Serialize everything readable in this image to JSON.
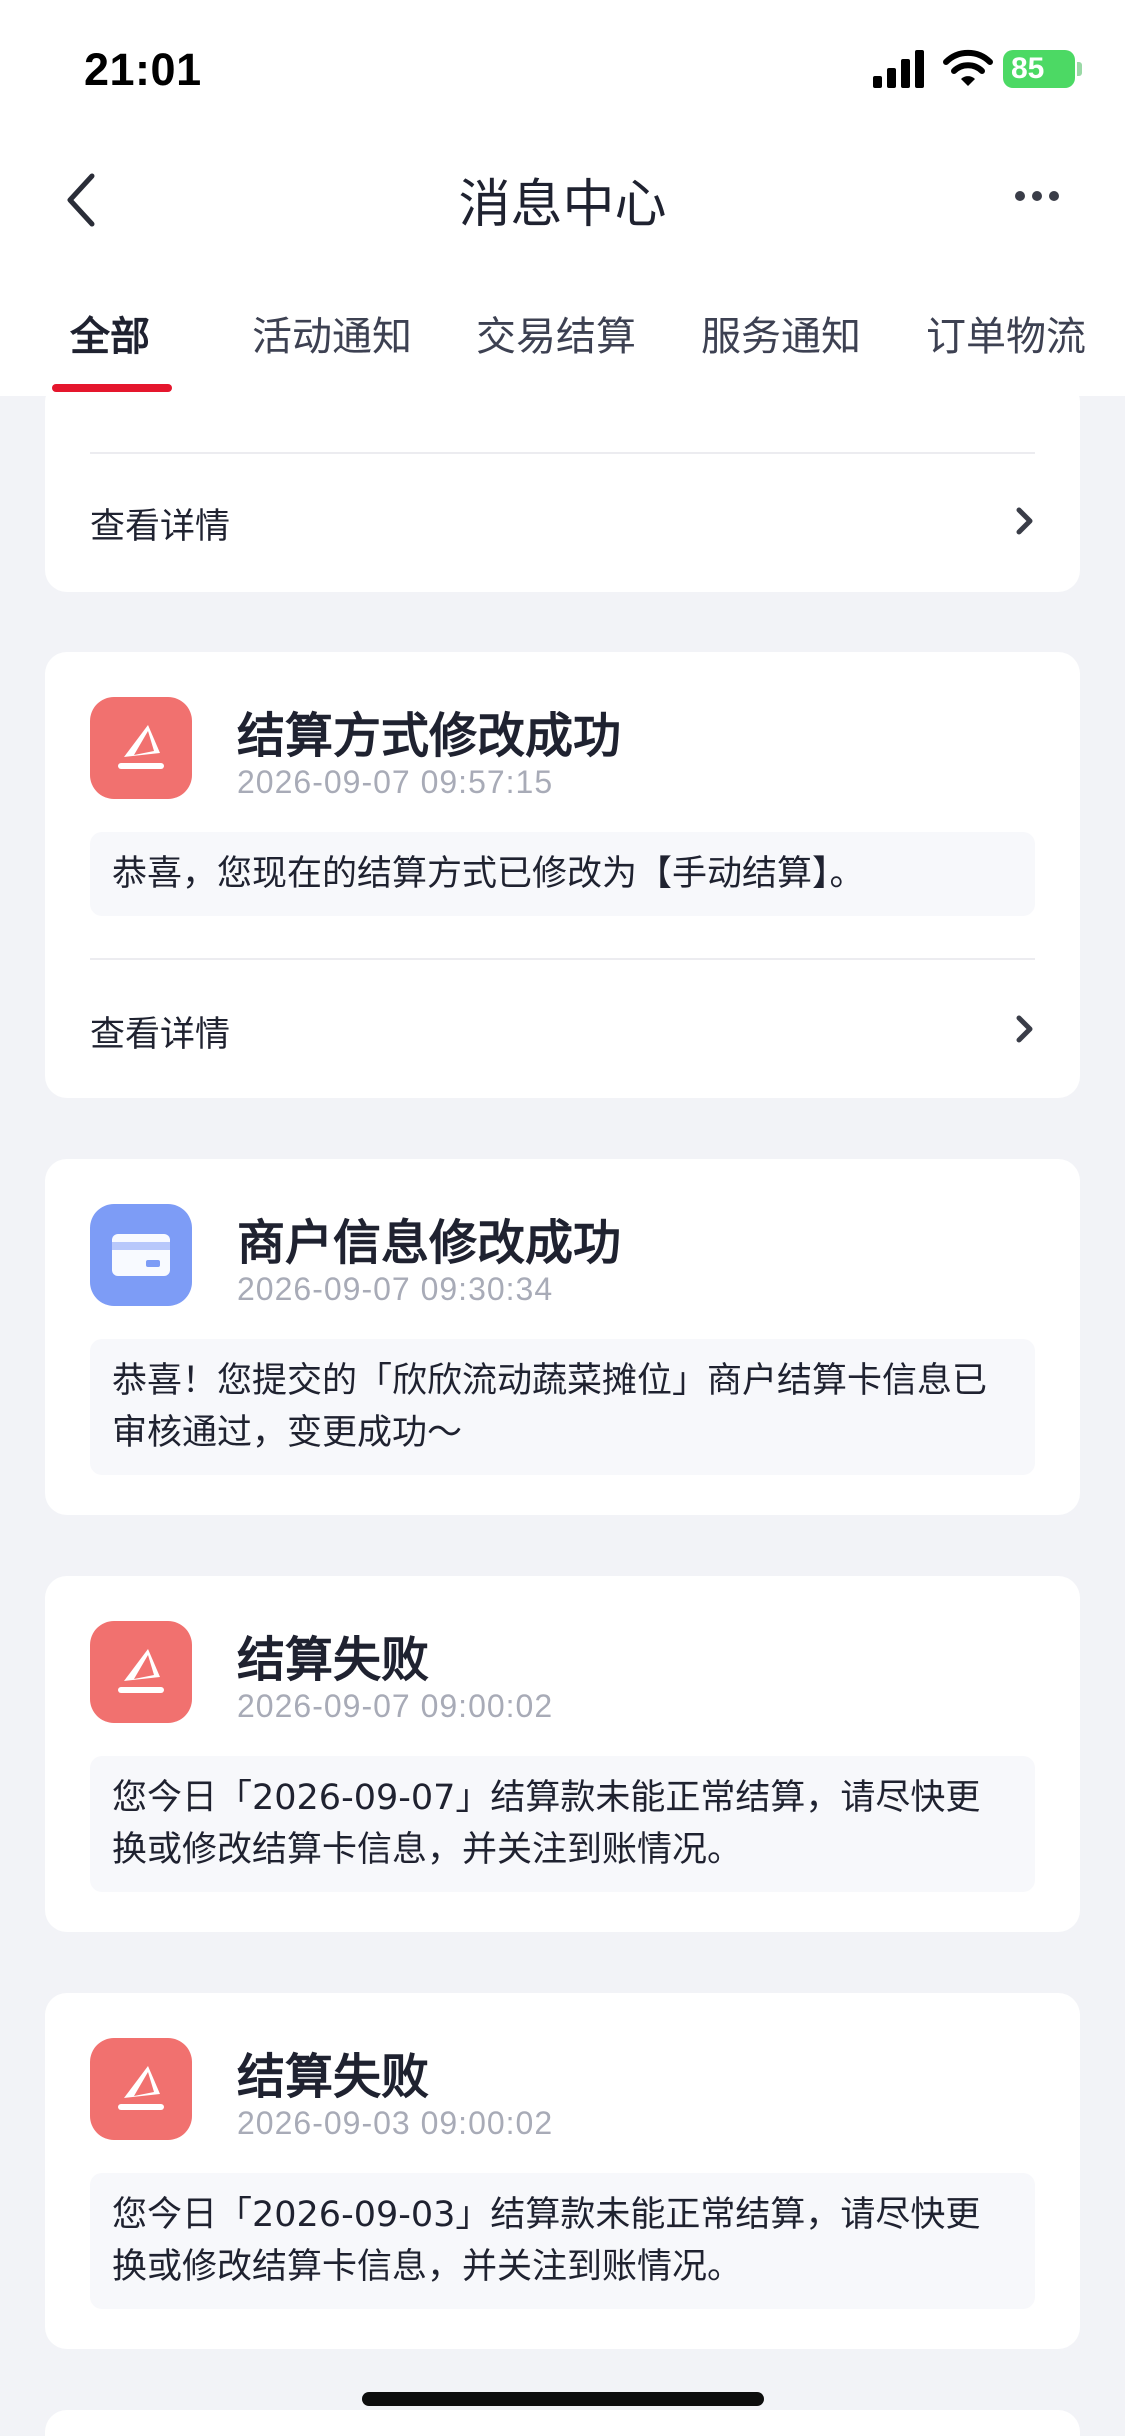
{
  "status_bar": {
    "time": "21:01",
    "battery": "85"
  },
  "nav": {
    "title": "消息中心"
  },
  "tabs": [
    {
      "label": "全部"
    },
    {
      "label": "活动通知"
    },
    {
      "label": "交易结算"
    },
    {
      "label": "服务通知"
    },
    {
      "label": "订单物流"
    }
  ],
  "messages": [
    {
      "detail_label": "查看详情"
    },
    {
      "icon": "settlement-icon",
      "title": "结算方式修改成功",
      "time": "2026-09-07 09:57:15",
      "body": "恭喜，您现在的结算方式已修改为【手动结算】。",
      "detail_label": "查看详情"
    },
    {
      "icon": "card-icon",
      "title": "商户信息修改成功",
      "time": "2026-09-07 09:30:34",
      "body": "恭喜！您提交的「欣欣流动蔬菜摊位」商户结算卡信息已审核通过，变更成功～"
    },
    {
      "icon": "settlement-icon",
      "title": "结算失败",
      "time": "2026-09-07 09:00:02",
      "body": "您今日「2026-09-07」结算款未能正常结算，请尽快更换或修改结算卡信息，并关注到账情况。"
    },
    {
      "icon": "settlement-icon",
      "title": "结算失败",
      "time": "2026-09-03 09:00:02",
      "body": "您今日「2026-09-03」结算款未能正常结算，请尽快更换或修改结算卡信息，并关注到账情况。"
    }
  ],
  "colors": {
    "accent": "#e5162d",
    "icon_red": "#f1716f",
    "icon_blue": "#7d9cf6",
    "background": "#f2f3f7"
  }
}
